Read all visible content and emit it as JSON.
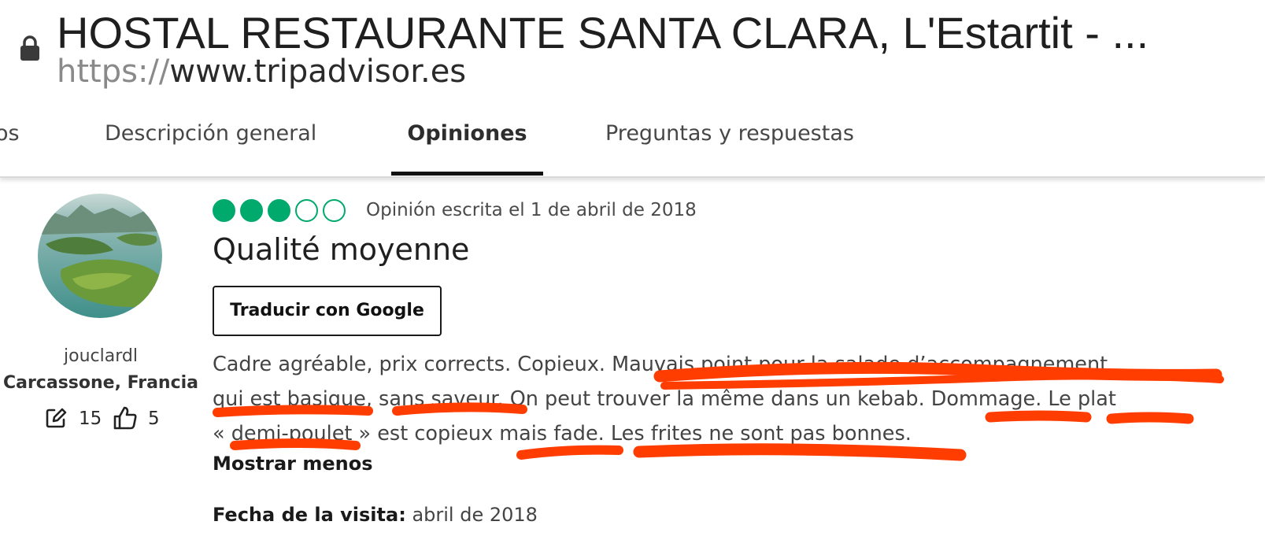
{
  "browser": {
    "page_title": "HOSTAL RESTAURANTE SANTA CLARA, L'Estartit - ...",
    "url_scheme": "https://",
    "url_host": "www.tripadvisor.es"
  },
  "tabs": [
    {
      "label": "os"
    },
    {
      "label": "Descripción general"
    },
    {
      "label": "Opiniones",
      "active": true
    },
    {
      "label": "Preguntas y respuestas"
    }
  ],
  "reviewer": {
    "username": "jouclardl",
    "location": "Carcassone, Francia",
    "contributions": "15",
    "helpful_votes": "5"
  },
  "review": {
    "rating": 3,
    "rating_max": 5,
    "date_text": "Opinión escrita el 1 de abril de 2018",
    "title": "Qualité moyenne",
    "translate_label": "Traducir con Google",
    "body_lines": [
      "Cadre agréable, prix corrects. Copieux. Mauvais point pour la salade d’accompagnement",
      "qui est basique, sans saveur. On peut trouver la même dans un kebab. Dommage. Le plat",
      "« demi-poulet » est copieux mais fade. Les frites ne sont pas bonnes."
    ],
    "show_less_label": "Mostrar menos",
    "visit_label": "Fecha de la visita:",
    "visit_value": "abril de 2018"
  },
  "colors": {
    "rating_green": "#00aa6c",
    "annotation_red": "#ff3d00",
    "tab_underline": "#111111"
  },
  "icons": [
    "lock-icon",
    "edit-icon",
    "thumbs-up-icon"
  ]
}
